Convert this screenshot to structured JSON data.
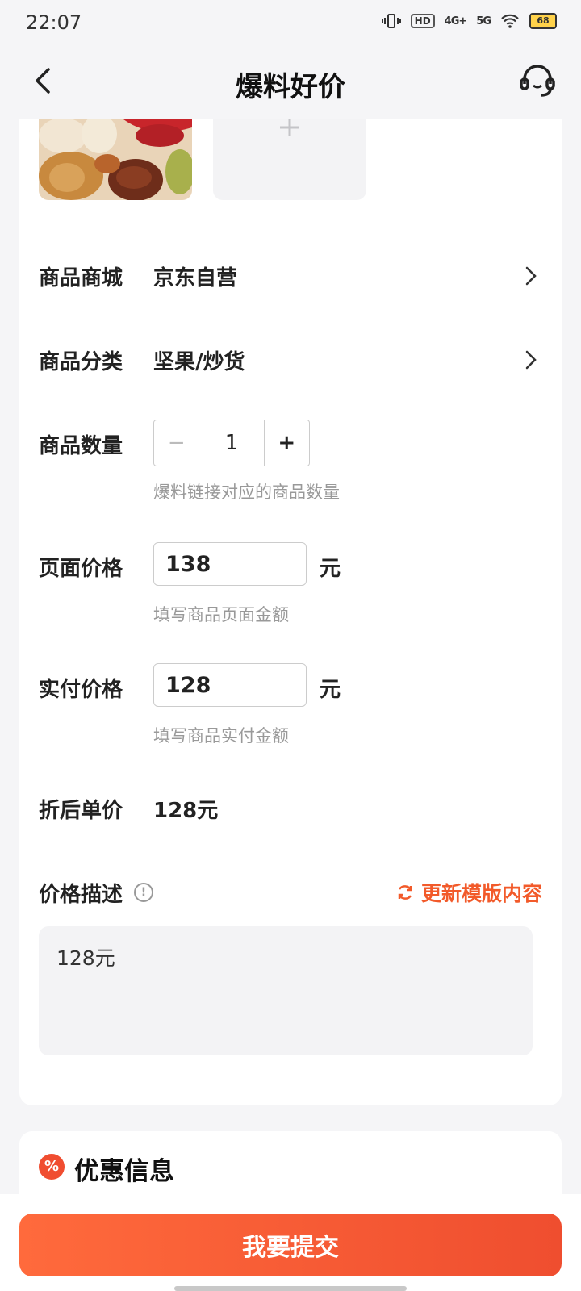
{
  "status": {
    "time": "22:07",
    "hd": "HD",
    "net1": "4G+",
    "net2": "5G",
    "battery": "68"
  },
  "header": {
    "title": "爆料好价"
  },
  "form": {
    "mall": {
      "label": "商品商城",
      "value": "京东自营"
    },
    "category": {
      "label": "商品分类",
      "value": "坚果/炒货"
    },
    "quantity": {
      "label": "商品数量",
      "minus": "−",
      "value": "1",
      "plus": "+",
      "hint": "爆料链接对应的商品数量"
    },
    "page_price": {
      "label": "页面价格",
      "value": "138",
      "unit": "元",
      "hint": "填写商品页面金额"
    },
    "paid_price": {
      "label": "实付价格",
      "value": "128",
      "unit": "元",
      "hint": "填写商品实付金额"
    },
    "unit_price": {
      "label": "折后单价",
      "value": "128元"
    },
    "price_desc": {
      "label": "价格描述",
      "refresh_label": "更新模版内容",
      "text": "128元"
    }
  },
  "discount": {
    "title": "优惠信息"
  },
  "submit": {
    "label": "我要提交"
  },
  "colors": {
    "accent": "#f25a2a",
    "button_start": "#ff6a3c",
    "button_end": "#ef4e2f"
  }
}
